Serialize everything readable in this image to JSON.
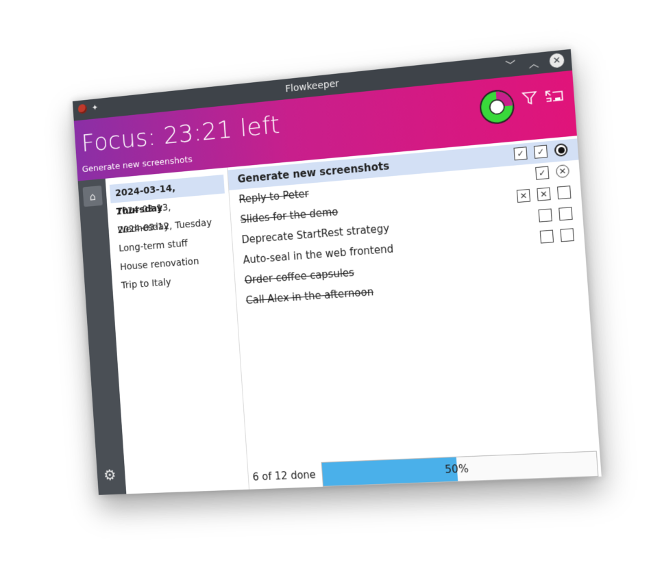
{
  "window": {
    "title": "Flowkeeper"
  },
  "header": {
    "focus_title": "Focus: 23:21 left",
    "focus_subtitle": "Generate new screenshots",
    "timer_progress": 0.25,
    "icons": [
      "filter-icon",
      "switch-icon"
    ]
  },
  "colors": {
    "header_gradient_start": "#8a2fa6",
    "header_gradient_end": "#e0147a",
    "timer_green": "#39d83b",
    "selection": "#d3e0f5",
    "progress_fill": "#4ab0ea"
  },
  "backlogs": [
    {
      "label": "2024-03-14, Thursday",
      "selected": true
    },
    {
      "label": "2024-03-13, Wednesday"
    },
    {
      "label": "2024-03-12, Tuesday"
    },
    {
      "label": "Long-term stuff"
    },
    {
      "label": "House renovation"
    },
    {
      "label": "Trip to Italy"
    }
  ],
  "tasks": [
    {
      "label": "Generate new screenshots",
      "selected": true,
      "done": false,
      "pomodoros": [
        "check",
        "check",
        "running"
      ]
    },
    {
      "label": "Reply to Peter",
      "done": true,
      "pomodoros": [
        "check",
        "void"
      ]
    },
    {
      "label": "Slides for the demo",
      "done": true,
      "pomodoros": [
        "cross",
        "cross",
        "empty"
      ]
    },
    {
      "label": "Deprecate StartRest strategy",
      "done": false,
      "pomodoros": [
        "empty",
        "empty"
      ]
    },
    {
      "label": "Auto-seal in the web frontend",
      "done": false,
      "pomodoros": [
        "empty",
        "empty"
      ]
    },
    {
      "label": "Order coffee capsules",
      "done": true,
      "pomodoros": []
    },
    {
      "label": "Call Alex in the afternoon",
      "done": true,
      "pomodoros": []
    }
  ],
  "footer": {
    "done_label": "6 of 12 done",
    "progress_text": "50%",
    "progress_value": 0.5
  }
}
